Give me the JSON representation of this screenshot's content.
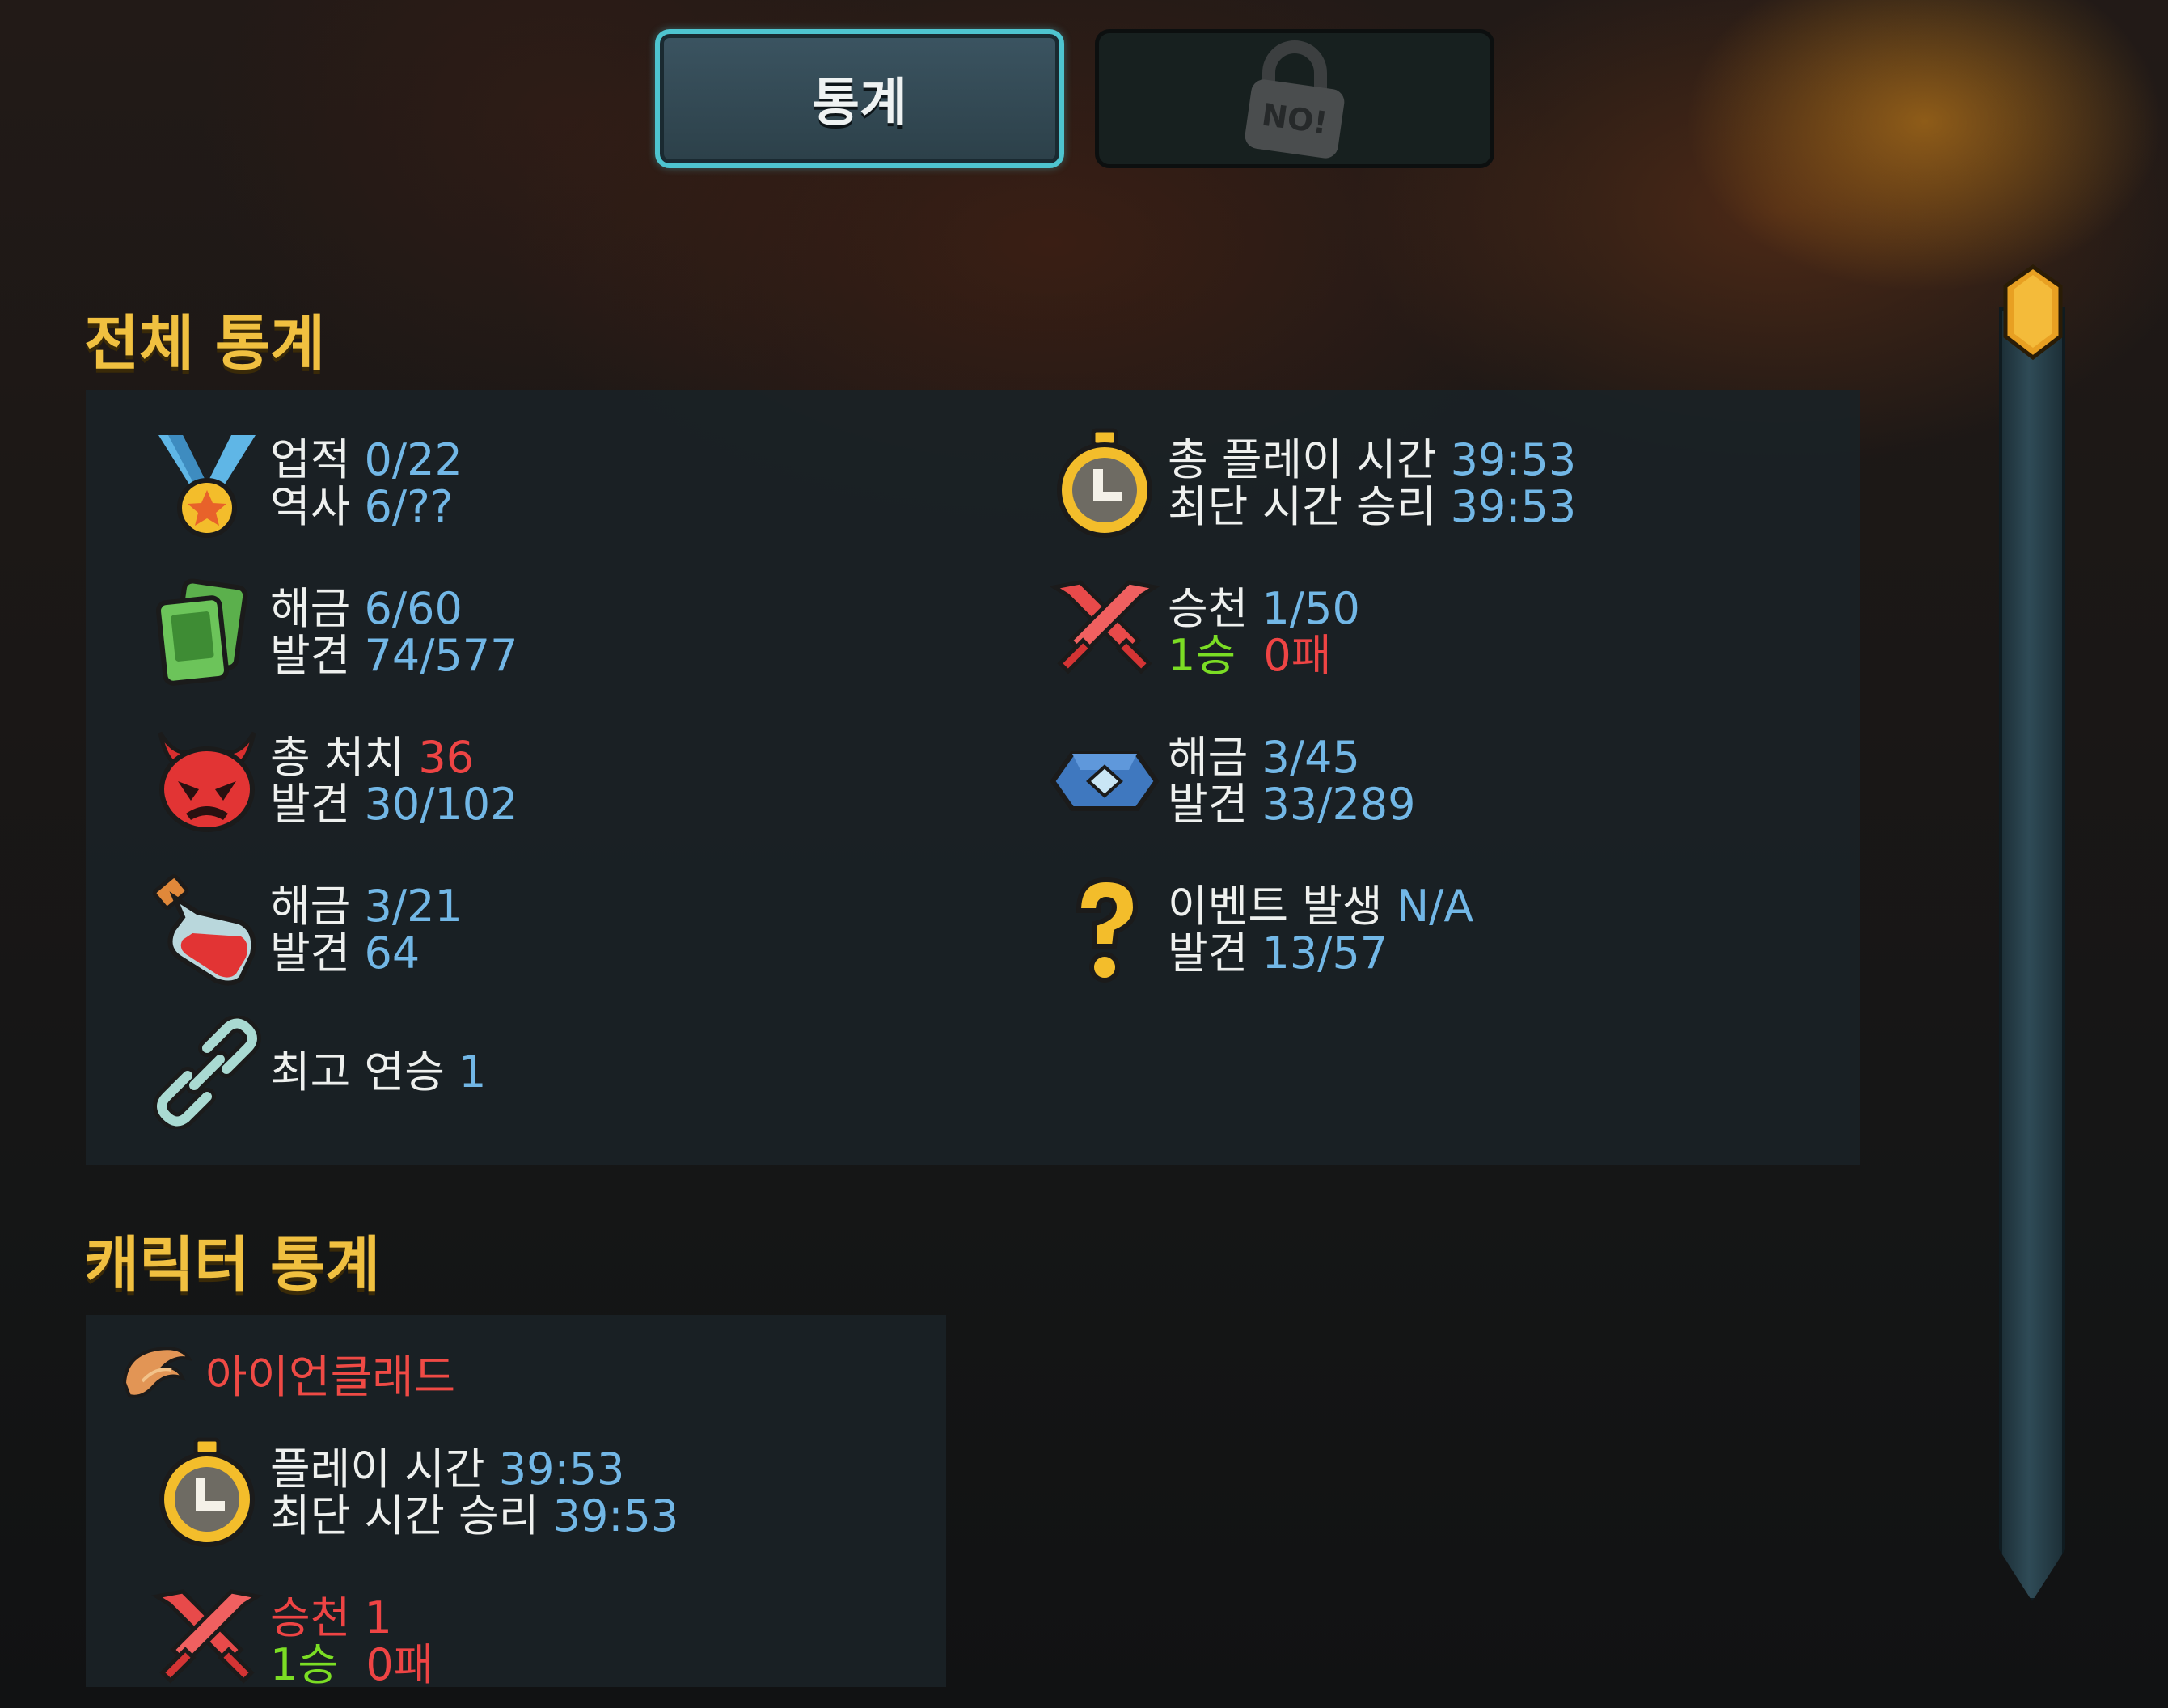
{
  "tabs": {
    "stats_label": "통계",
    "locked_badge": "NO!"
  },
  "overall": {
    "title": "전체 통계",
    "left": [
      {
        "icon": "medal-icon",
        "lines": [
          [
            "업적",
            "0/22"
          ],
          [
            "역사",
            "6/??"
          ]
        ]
      },
      {
        "icon": "cards-icon",
        "lines": [
          [
            "해금",
            "6/60"
          ],
          [
            "발견",
            "74/577"
          ]
        ]
      },
      {
        "icon": "demon-skull-icon",
        "lines": [
          [
            "총 처치",
            "36"
          ],
          [
            "발견",
            "30/102"
          ]
        ]
      },
      {
        "icon": "potion-icon",
        "lines": [
          [
            "해금",
            "3/21"
          ],
          [
            "발견",
            "64"
          ]
        ]
      },
      {
        "icon": "chain-link-icon",
        "lines": [
          [
            "최고 연승",
            "1"
          ]
        ]
      }
    ],
    "right": [
      {
        "icon": "stopwatch-icon",
        "lines": [
          [
            "총 플레이 시간",
            "39:53"
          ],
          [
            "최단 시간 승리",
            "39:53"
          ]
        ]
      },
      {
        "icon": "crossed-swords-icon",
        "ascension_label": "승천",
        "ascension_value": "1/50",
        "wins": "1승",
        "losses": "0패"
      },
      {
        "icon": "relic-gem-icon",
        "lines": [
          [
            "해금",
            "3/45"
          ],
          [
            "발견",
            "33/289"
          ]
        ]
      },
      {
        "icon": "question-mark-icon",
        "lines": [
          [
            "이벤트 발생",
            "N/A"
          ],
          [
            "발견",
            "13/57"
          ]
        ]
      }
    ]
  },
  "character": {
    "title": "캐릭터 통계",
    "name": "아이언클래드",
    "playtime_label": "플레이 시간",
    "playtime_value": "39:53",
    "fastest_label": "최단 시간 승리",
    "fastest_value": "39:53",
    "ascension_label": "승천",
    "ascension_value": "1",
    "wins": "1승",
    "losses": "0패"
  },
  "colors": {
    "title_gold": "#f0c040",
    "value_blue": "#72b7e6",
    "loss_red": "#ee4444",
    "win_green": "#7bdd24",
    "tab_border": "#4ec4cf"
  }
}
